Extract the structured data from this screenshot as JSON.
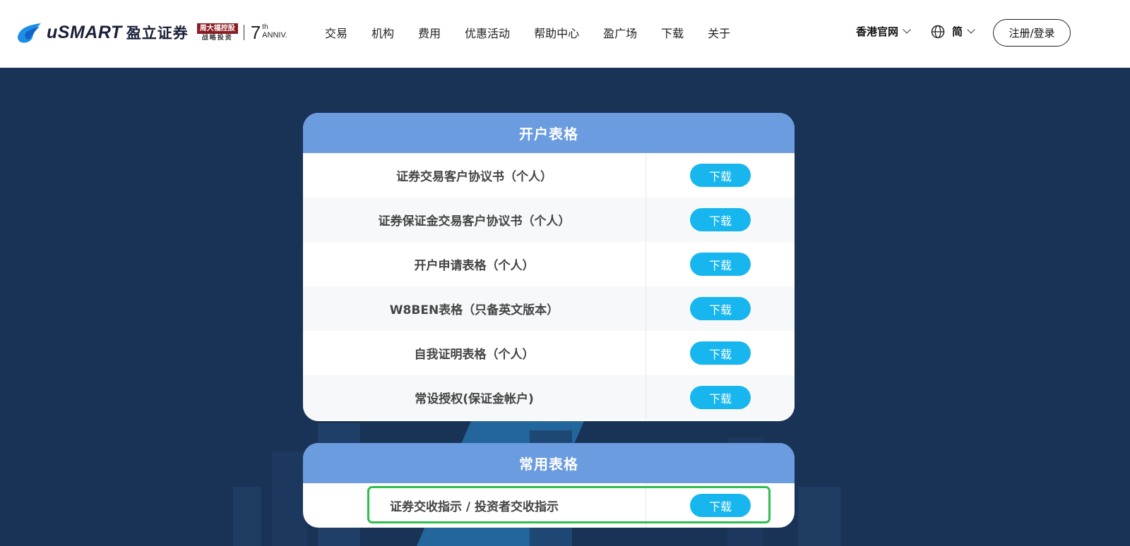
{
  "header": {
    "brand_name": "uSMART",
    "brand_cn": "盈立证券",
    "partner_top": "周大福控股",
    "partner_bottom": "战略投资",
    "anniv_num": "7",
    "anniv_sup": "th",
    "anniv_sub": "ANNIV.",
    "nav": [
      "交易",
      "机构",
      "费用",
      "优惠活动",
      "帮助中心",
      "盈广场",
      "下载",
      "关于"
    ],
    "region": "香港官网",
    "language": "简",
    "login_label": "注册/登录"
  },
  "account_forms": {
    "title": "开户表格",
    "rows": [
      {
        "label": "证券交易客户协议书（个人）",
        "action": "下载"
      },
      {
        "label": "证券保证金交易客户协议书（个人）",
        "action": "下载"
      },
      {
        "label": "开户申请表格（个人）",
        "action": "下载"
      },
      {
        "label": "W8BEN表格（只备英文版本）",
        "action": "下载"
      },
      {
        "label": "自我证明表格（个人）",
        "action": "下载"
      },
      {
        "label": "常设授权(保证金帐户)",
        "action": "下载"
      }
    ]
  },
  "common_forms": {
    "title": "常用表格",
    "rows": [
      {
        "label": "证券交收指示 / 投资者交收指示",
        "action": "下载"
      }
    ]
  },
  "colors": {
    "page_bg": "#183356",
    "card_header": "#6b9ce0",
    "download_button": "#17b6ee",
    "highlight": "#2fbf4e"
  },
  "icons": [
    "logo-mark-icon",
    "chevron-down-icon",
    "globe-icon"
  ]
}
